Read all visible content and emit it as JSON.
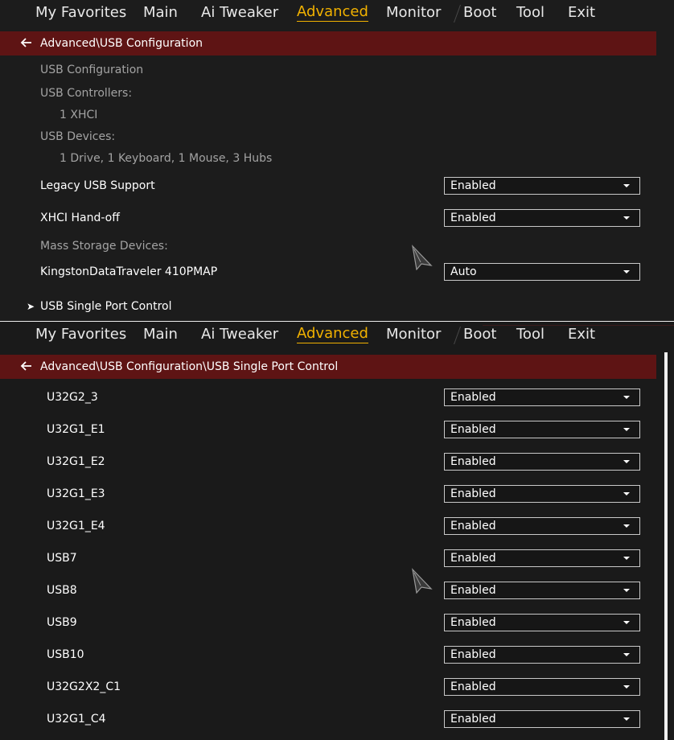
{
  "nav": {
    "items": [
      "My Favorites",
      "Main",
      "Ai Tweaker",
      "Advanced",
      "Monitor",
      "Boot",
      "Tool",
      "Exit"
    ],
    "active": "Advanced"
  },
  "panel1": {
    "breadcrumb": "Advanced\\USB Configuration",
    "usb_configuration": "USB Configuration",
    "usb_controllers_label": "USB Controllers:",
    "usb_controllers_value": "1 XHCI",
    "usb_devices_label": "USB Devices:",
    "usb_devices_value": "1 Drive, 1 Keyboard, 1 Mouse, 3 Hubs",
    "legacy_usb_label": "Legacy USB Support",
    "legacy_usb_value": "Enabled",
    "xhci_handoff_label": "XHCI Hand-off",
    "xhci_handoff_value": "Enabled",
    "mass_storage_label": "Mass Storage Devices:",
    "kingston_label": "KingstonDataTraveler 410PMAP",
    "kingston_value": "Auto",
    "single_port_marker": "➤",
    "single_port_label": "USB Single Port Control"
  },
  "panel2": {
    "breadcrumb": "Advanced\\USB Configuration\\USB Single Port Control",
    "ports": [
      {
        "label": "U32G2_3",
        "value": "Enabled"
      },
      {
        "label": "U32G1_E1",
        "value": "Enabled"
      },
      {
        "label": "U32G1_E2",
        "value": "Enabled"
      },
      {
        "label": "U32G1_E3",
        "value": "Enabled"
      },
      {
        "label": "U32G1_E4",
        "value": "Enabled"
      },
      {
        "label": "USB7",
        "value": "Enabled"
      },
      {
        "label": "USB8",
        "value": "Enabled"
      },
      {
        "label": "USB9",
        "value": "Enabled"
      },
      {
        "label": "USB10",
        "value": "Enabled"
      },
      {
        "label": "U32G2X2_C1",
        "value": "Enabled"
      },
      {
        "label": "U32G1_C4",
        "value": "Enabled"
      }
    ]
  },
  "icons": {
    "back": "arrow-left-icon",
    "cursor": "mouse-pointer-icon",
    "dropdown": "caret-down-icon",
    "submenu": "submenu-arrow-icon"
  },
  "colors": {
    "accent": "#f1b100",
    "breadcrumb_bg": "#5e1414",
    "background": "#1c1c1c"
  }
}
